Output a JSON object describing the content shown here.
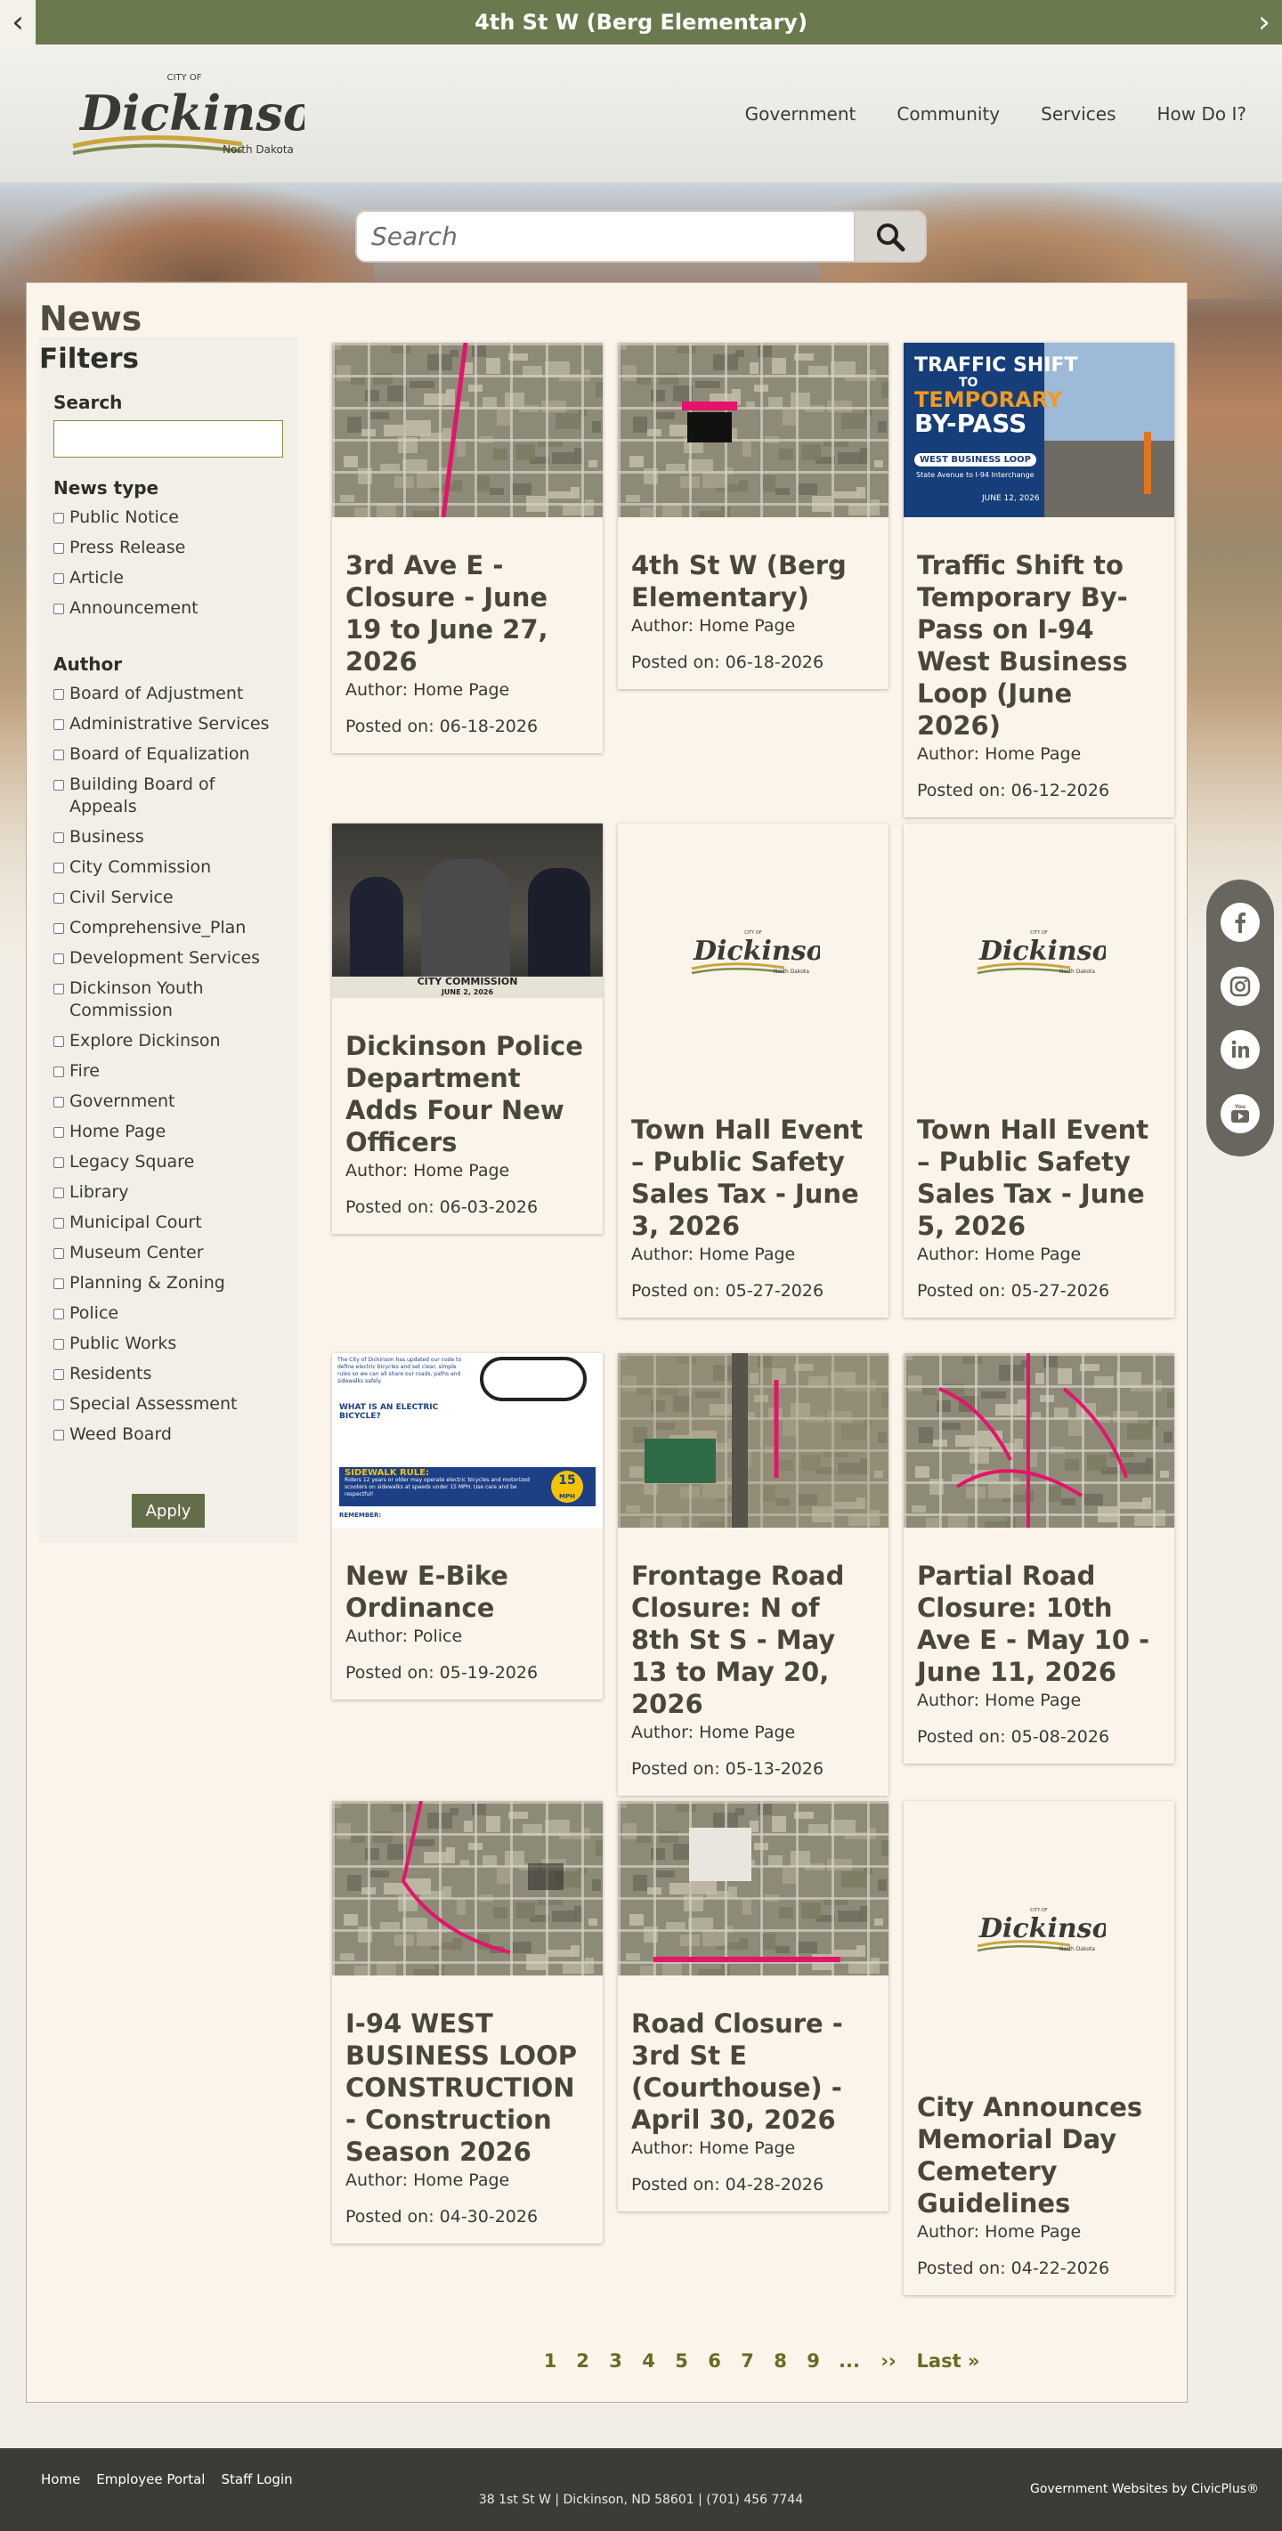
{
  "alert": {
    "title": "4th St W (Berg Elementary)",
    "prev_glyph": "‹",
    "next_glyph": "›"
  },
  "logo": {
    "top": "CITY OF",
    "name": "Dickinson",
    "sub": "North Dakota"
  },
  "nav": {
    "items": [
      "Government",
      "Community",
      "Services",
      "How Do I?"
    ]
  },
  "search": {
    "placeholder": "Search"
  },
  "page": {
    "title": "News"
  },
  "filters": {
    "title": "Filters",
    "search_label": "Search",
    "news_type_title": "News type",
    "news_types": [
      "Public Notice",
      "Press Release",
      "Article",
      "Announcement"
    ],
    "author_title": "Author",
    "authors": [
      "Board of Adjustment",
      "Administrative Services",
      "Board of Equalization",
      "Building Board of Appeals",
      "Business",
      "City Commission",
      "Civil Service",
      "Comprehensive_Plan",
      "Development Services",
      "Dickinson Youth Commission",
      "Explore Dickinson",
      "Fire",
      "Government",
      "Home Page",
      "Legacy Square",
      "Library",
      "Municipal Court",
      "Museum Center",
      "Planning & Zoning",
      "Police",
      "Public Works",
      "Residents",
      "Special Assessment",
      "Weed Board"
    ],
    "apply_label": "Apply"
  },
  "cards": [
    {
      "title": "3rd Ave E - Closure - June 19 to June 27, 2026",
      "author": "Author: Home Page",
      "posted": "Posted on: 06-18-2026",
      "thumb": "aerial-map-road"
    },
    {
      "title": "4th St W (Berg Elementary)",
      "author": "Author: Home Page",
      "posted": "Posted on: 06-18-2026",
      "thumb": "aerial-map-school"
    },
    {
      "title": "Traffic Shift to Temporary By-Pass on I-94 West Business Loop (June 2026)",
      "author": "Author: Home Page",
      "posted": "Posted on: 06-12-2026",
      "thumb": "traffic-shift-graphic",
      "graphic": {
        "line1": "TRAFFIC SHIFT",
        "line2": "TO",
        "line3": "TEMPORARY",
        "line4": "BY-PASS",
        "badge": "WEST BUSINESS LOOP",
        "route": "State Avenue to I-94 Interchange",
        "date": "JUNE 12, 2026"
      }
    },
    {
      "title": "Dickinson Police Department Adds Four New Officers",
      "author": "Author: Home Page",
      "posted": "Posted on: 06-03-2026",
      "thumb": "photo-swearing-in",
      "caption": {
        "line1": "CITY COMMISSION",
        "line2": "JUNE 2, 2026"
      }
    },
    {
      "title": "Town Hall Event – Public Safety Sales Tax - June 3, 2026",
      "author": "Author: Home Page",
      "posted": "Posted on: 05-27-2026",
      "thumb": "city-logo"
    },
    {
      "title": "Town Hall Event – Public Safety Sales Tax - June 5, 2026",
      "author": "Author: Home Page",
      "posted": "Posted on: 05-27-2026",
      "thumb": "city-logo"
    },
    {
      "title": "New E-Bike Ordinance",
      "author": "Author: Police",
      "posted": "Posted on: 05-19-2026",
      "thumb": "ebike-infographic",
      "graphic": {
        "intro": "The City of Dickinson has updated our code to define electric bicycles and set clear, simple rules so we can all share our roads, paths and sidewalks safely.",
        "q": "WHAT IS AN ELECTRIC BICYCLE?",
        "rule_title": "SIDEWALK RULE:",
        "rule_text": "Riders 12 years or older may operate electric bicycles and motorized scooters on sidewalks at speeds under 15 MPH. Use care and be respectful!",
        "speed": "15",
        "speed_unit": "MPH",
        "remember": "REMEMBER:"
      }
    },
    {
      "title": "Frontage Road Closure: N of 8th St S - May 13 to May 20, 2026",
      "author": "Author: Home Page",
      "posted": "Posted on: 05-13-2026",
      "thumb": "aerial-map-frontage"
    },
    {
      "title": "Partial Road Closure: 10th Ave E - May 10 - June 11, 2026",
      "author": "Author: Home Page",
      "posted": "Posted on: 05-08-2026",
      "thumb": "aerial-map-neighborhood"
    },
    {
      "title": "I-94 WEST BUSINESS LOOP CONSTRUCTION - Construction Season 2026",
      "author": "Author: Home Page",
      "posted": "Posted on: 04-30-2026",
      "thumb": "aerial-map-loop"
    },
    {
      "title": "Road Closure - 3rd St E (Courthouse) - April 30, 2026",
      "author": "Author: Home Page",
      "posted": "Posted on: 04-28-2026",
      "thumb": "aerial-map-courthouse"
    },
    {
      "title": "City Announces Memorial Day Cemetery Guidelines",
      "author": "Author: Home Page",
      "posted": "Posted on: 04-22-2026",
      "thumb": "city-logo"
    }
  ],
  "social": [
    "facebook-icon",
    "instagram-icon",
    "linkedin-icon",
    "youtube-icon"
  ],
  "pager": {
    "pages": [
      "1",
      "2",
      "3",
      "4",
      "5",
      "6",
      "7",
      "8",
      "9",
      "...",
      "››",
      "Last »"
    ]
  },
  "footer": {
    "links": [
      "Home",
      "Employee Portal",
      "Staff Login"
    ],
    "address": "38 1st St W | Dickinson, ND 58601 | (701) 456 7744",
    "credit": "Government Websites by CivicPlus®"
  },
  "colors": {
    "alert_bg": "#6a7a4e",
    "title_text": "#4a4638",
    "pager_link": "#6b6a22",
    "footer_bg": "#3c3b37",
    "highlight_road": "#e6136a",
    "apply_bg": "#646d4a"
  }
}
